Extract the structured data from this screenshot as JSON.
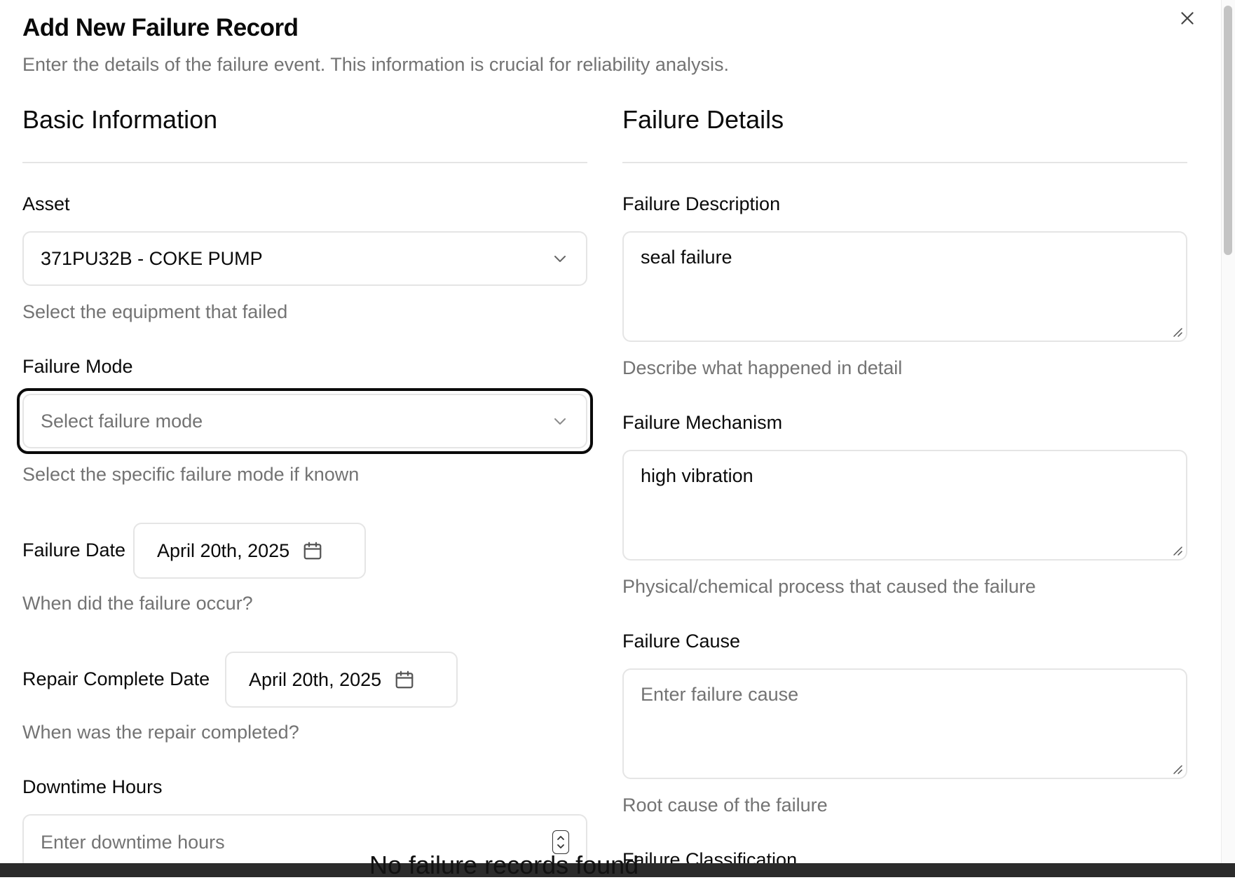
{
  "dialog": {
    "title": "Add New Failure Record",
    "description": "Enter the details of the failure event. This information is crucial for reliability analysis.",
    "close_icon": "close-icon"
  },
  "basic_info": {
    "heading": "Basic Information",
    "asset": {
      "label": "Asset",
      "value": "371PU32B - COKE PUMP",
      "hint": "Select the equipment that failed"
    },
    "failure_mode": {
      "label": "Failure Mode",
      "placeholder": "Select failure mode",
      "hint": "Select the specific failure mode if known"
    },
    "failure_date": {
      "label": "Failure Date",
      "value": "April 20th, 2025",
      "hint": "When did the failure occur?"
    },
    "repair_complete_date": {
      "label": "Repair Complete Date",
      "value": "April 20th, 2025",
      "hint": "When was the repair completed?"
    },
    "downtime_hours": {
      "label": "Downtime Hours",
      "placeholder": "Enter downtime hours"
    }
  },
  "failure_details": {
    "heading": "Failure Details",
    "description": {
      "label": "Failure Description",
      "value": "seal failure",
      "hint": "Describe what happened in detail"
    },
    "mechanism": {
      "label": "Failure Mechanism",
      "value": "high vibration",
      "hint": "Physical/chemical process that caused the failure"
    },
    "cause": {
      "label": "Failure Cause",
      "placeholder": "Enter failure cause",
      "hint": "Root cause of the failure"
    },
    "classification": {
      "label": "Failure Classification"
    }
  },
  "background": {
    "empty_text": "No failure records found"
  },
  "colors": {
    "text": "#0a0a0a",
    "muted": "#737373",
    "border": "#e5e5e5",
    "focus_ring": "#0a0a0a"
  }
}
